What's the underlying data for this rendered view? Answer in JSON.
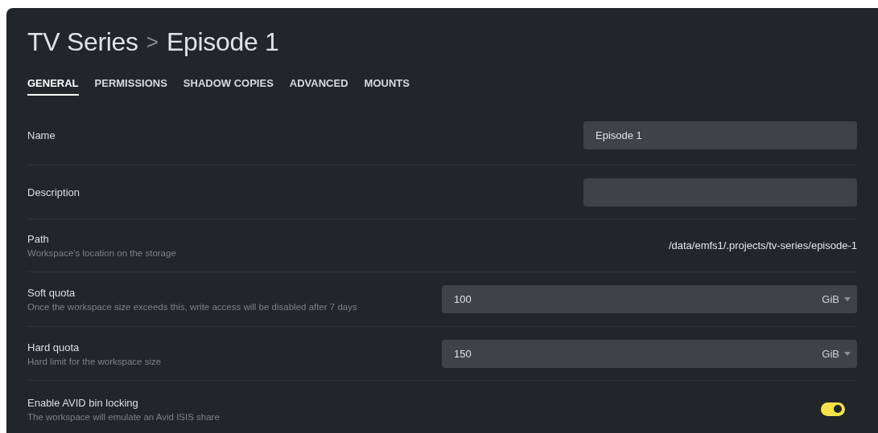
{
  "breadcrumb": {
    "parent": "TV Series",
    "separator": ">",
    "current": "Episode 1"
  },
  "tabs": [
    {
      "label": "GENERAL",
      "selected": true
    },
    {
      "label": "PERMISSIONS",
      "selected": false
    },
    {
      "label": "SHADOW COPIES",
      "selected": false
    },
    {
      "label": "ADVANCED",
      "selected": false
    },
    {
      "label": "MOUNTS",
      "selected": false
    }
  ],
  "settings": [
    {
      "kind": "text",
      "label": "Name",
      "value": "Episode 1"
    },
    {
      "kind": "text",
      "label": "Description"
    },
    {
      "kind": "path",
      "label": "Path",
      "description": "Workspace's location on the storage",
      "value": "/data/emfs1/.projects/tv-series/episode-1"
    },
    {
      "kind": "quota",
      "label": "Soft quota",
      "description": "Once the workspace size exceeds this, write access will be disabled after 7 days",
      "value": "100",
      "unit": "GiB"
    },
    {
      "kind": "quota",
      "label": "Hard quota",
      "description": "Hard limit for the workspace size",
      "value": "150",
      "unit": "GiB"
    },
    {
      "kind": "toggle",
      "label": "Enable AVID bin locking",
      "description": "The workspace will emulate an Avid ISIS share",
      "on": true
    }
  ]
}
